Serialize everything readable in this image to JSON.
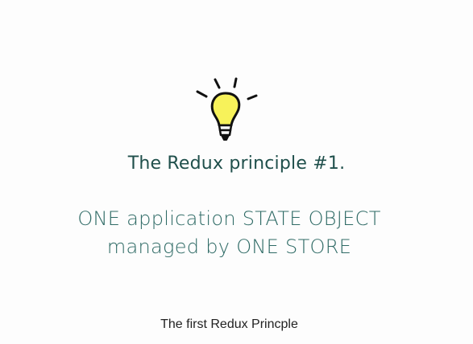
{
  "slide": {
    "icon": "lightbulb-icon",
    "heading": "The Redux principle #1.",
    "statement_line1": "ONE application STATE OBJECT",
    "statement_line2": "managed by ONE STORE",
    "caption": "The first Redux Princple",
    "colors": {
      "heading": "#1f4f4b",
      "statement": "#2e6a65",
      "bulb_fill": "#f7f25a",
      "caption": "#222222"
    }
  }
}
